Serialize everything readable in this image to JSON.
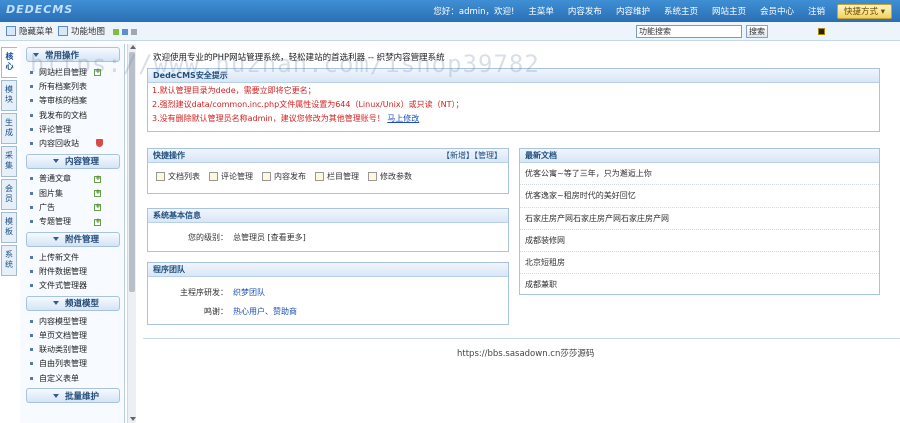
{
  "topbar": {
    "logo": "DEDECMS",
    "greeting": "您好：admin，欢迎!",
    "nav": [
      "主菜单",
      "内容发布",
      "内容维护",
      "系统主页",
      "网站主页",
      "会员中心",
      "注销"
    ],
    "quick_label": "快捷方式 ▾"
  },
  "toolbar": {
    "hide_menu": "隐藏菜单",
    "func_map": "功能地图",
    "search_value": "功能搜索",
    "search_button": "搜索"
  },
  "vtabs": [
    "核心",
    "模块",
    "生成",
    "采集",
    "会员",
    "模板",
    "系统"
  ],
  "sidebar": {
    "groups": [
      {
        "title": "常用操作",
        "items": [
          "网站栏目管理",
          "所有档案列表",
          "等审核的档案",
          "我发布的文档",
          "评论管理",
          "内容回收站"
        ]
      },
      {
        "title": "内容管理",
        "items": [
          "普通文章",
          "图片集",
          "广告",
          "专题管理"
        ]
      },
      {
        "title": "附件管理",
        "items": [
          "上传新文件",
          "附件数据管理",
          "文件式管理器"
        ]
      },
      {
        "title": "频道模型",
        "items": [
          "内容模型管理",
          "单页文档管理",
          "联动类别管理",
          "自由列表管理",
          "自定义表单"
        ]
      },
      {
        "title": "批量维护",
        "items": []
      }
    ]
  },
  "welcome": "欢迎使用专业的PHP网站管理系统，轻松建站的首选利器 -- 织梦内容管理系统",
  "security": {
    "title": "DedeCMS安全提示",
    "lines": [
      "1.默认管理目录为dede，需要立即将它更名；",
      "2.强烈建议data/common.inc.php文件属性设置为644（Linux/Unix）或只读（NT）；",
      "3.没有删除默认管理员名称admin，建议您修改为其他管理账号！"
    ],
    "fix_link": "马上修改"
  },
  "quick": {
    "title": "快捷操作",
    "extra": "【新增】【管理】",
    "items": [
      "文档列表",
      "评论管理",
      "内容发布",
      "栏目管理",
      "修改参数"
    ]
  },
  "sysinfo": {
    "title": "系统基本信息",
    "level_label": "您的级别：",
    "level_value": "总管理员 [查看更多]"
  },
  "team": {
    "title": "程序团队",
    "dev_label": "主程序研发：",
    "dev_value": "织梦团队",
    "thanks_label": "鸣谢：",
    "thanks_value": "热心用户、赞助商"
  },
  "news": {
    "title": "最新文档",
    "items": [
      "优客公寓~等了三年，只为邂逅上你",
      "优客逸家~租房时代的美好回忆",
      "石家庄房产网石家庄房产网石家庄房产网",
      "成都装修网",
      "北京短租房",
      "成都兼职"
    ]
  },
  "footer": "https://bbs.sasadown.cn莎莎源码",
  "watermark": "https://www.huzhan.com/ishop39782",
  "colors": {
    "topbar": "#2a6fb5",
    "alert": "#d62020",
    "link": "#1d4fb5"
  }
}
